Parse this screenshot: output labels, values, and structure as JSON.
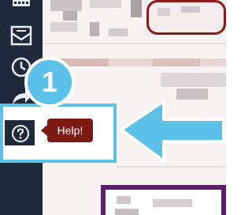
{
  "callout": {
    "step_number": "1"
  },
  "help": {
    "tooltip": "Help!"
  },
  "sidebar": {
    "icons": [
      "calendar-icon",
      "inbox-icon",
      "clock-icon",
      "share-icon",
      "help-icon"
    ]
  },
  "colors": {
    "sidebar_bg": "#1e2a3b",
    "accent_blue": "#5cc1e9",
    "tooltip_bg": "#7b1a13",
    "content_red": "#8b1a1a",
    "content_purple": "#5b1e6b"
  }
}
